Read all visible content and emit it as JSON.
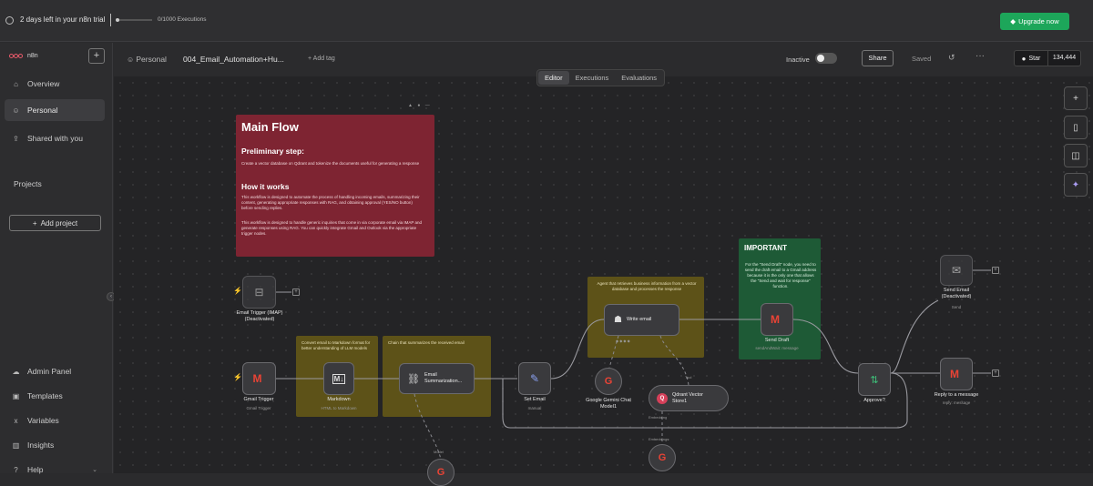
{
  "topbar": {
    "trial_text": "2 days left in your n8n trial",
    "executions_text": "0/1000 Executions",
    "upgrade_label": "Upgrade now",
    "upgrade_color": "#1da65a"
  },
  "sidebar": {
    "logo_text": "n8n",
    "add_button": "+",
    "items": [
      {
        "label": "Overview",
        "icon": "home-icon",
        "glyph": "⌂"
      },
      {
        "label": "Personal",
        "icon": "user-icon",
        "glyph": "👤"
      },
      {
        "label": "Shared with you",
        "icon": "share-icon",
        "glyph": "⇪"
      }
    ],
    "projects_title": "Projects",
    "add_project_label": "Add project",
    "bottom_items": [
      {
        "label": "Admin Panel",
        "icon": "cloud-icon",
        "glyph": "☁"
      },
      {
        "label": "Templates",
        "icon": "box-icon",
        "glyph": "▣"
      },
      {
        "label": "Variables",
        "icon": "variable-icon",
        "glyph": "𝑥"
      },
      {
        "label": "Insights",
        "icon": "chart-icon",
        "glyph": "▥"
      },
      {
        "label": "Help",
        "icon": "help-icon",
        "glyph": "?"
      }
    ]
  },
  "header": {
    "breadcrumb_project": "Personal",
    "workflow_name": "004_Email_Automation+Hu...",
    "add_tag": "+ Add tag",
    "inactive_label": "Inactive",
    "share_label": "Share",
    "saved_label": "Saved",
    "star_label": "Star",
    "star_count": "134,444"
  },
  "tabs": [
    {
      "label": "Editor",
      "active": true
    },
    {
      "label": "Executions",
      "active": false
    },
    {
      "label": "Evaluations",
      "active": false
    }
  ],
  "sticky_main": {
    "title": "Main Flow",
    "step_heading": "Preliminary step:",
    "step_text": "Create a vector database on Qdrant and tokenize the documents useful for generating a response",
    "how_heading": "How it works",
    "how_text_1": "This workflow is designed to automate the process of handling incoming emails, summarizing their content, generating appropriate responses with RAG, and obtaining approval (YES/NO button) before sending replies.",
    "how_text_2": "This workflow is designed to handle generic inquiries that come in via corporate email via IMAP and generate responses using RAG. You can quickly integrate Gmail and Outlook via the appropriate trigger nodes."
  },
  "sticky_markdown": {
    "text": "Convert email to Markdown format for better understanding of LLM models"
  },
  "sticky_chain": {
    "text": "Chain that summarizes the received email"
  },
  "sticky_agent": {
    "text": "Agent that retrieves business information from a vector database and processes the response"
  },
  "sticky_important": {
    "title": "IMPORTANT",
    "text": "For the \"Send Draft\" node, you need to send the draft email to a Gmail address because it is the only one that allows the \"Send and wait for response\" function."
  },
  "nodes": {
    "email_trigger_imap": {
      "label": "Email Trigger (IMAP)\n(Deactivated)"
    },
    "gmail_trigger": {
      "label": "Gmail Trigger",
      "sub": "Gmail Trigger"
    },
    "markdown": {
      "label": "Markdown",
      "sub": "HTML to Markdown"
    },
    "email_summarization": {
      "label": "Email\nSummarization..."
    },
    "set_email": {
      "label": "Set Email",
      "sub": "manual"
    },
    "write_email": {
      "label": "Write email"
    },
    "gemini": {
      "label": "Google Gemini Chat\nModel1"
    },
    "qdrant": {
      "label": "Qdrant Vector\nStore1"
    },
    "send_draft": {
      "label": "Send Draft",
      "sub": "sendAndWait: message"
    },
    "approve": {
      "label": "Approve?"
    },
    "reply": {
      "label": "Reply to a message",
      "sub": "reply: message"
    },
    "send_email": {
      "label": "Send Email\n(Deactivated)",
      "sub": "Send"
    }
  },
  "tags": {
    "tool": "Tool",
    "embedding_1": "Embedding",
    "embedding_2": "Embeddings",
    "model": "Model"
  },
  "colors": {
    "sticky_red": "#7e2432",
    "sticky_yellow": "#5d5218",
    "sticky_green": "#1e5a36",
    "gmail_red": "#ea4335"
  }
}
